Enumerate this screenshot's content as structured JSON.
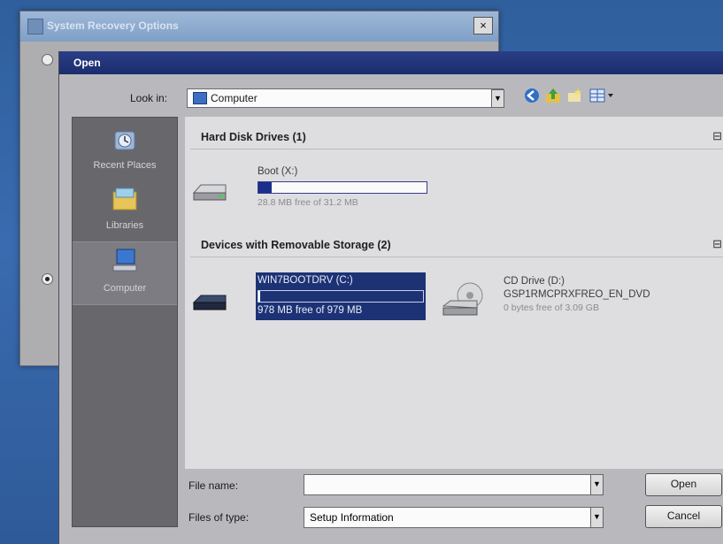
{
  "sro_window": {
    "title": "System Recovery Options",
    "close_label": "×"
  },
  "open_dialog": {
    "title": "Open",
    "look_in_label": "Look in:",
    "look_in_value": "Computer",
    "places": [
      {
        "label": "Recent Places"
      },
      {
        "label": "Libraries"
      },
      {
        "label": "Computer"
      }
    ],
    "groups": [
      {
        "title": "Hard Disk Drives (1)",
        "collapse": "⊟"
      },
      {
        "title": "Devices with Removable Storage (2)",
        "collapse": "⊟"
      }
    ],
    "drives": [
      {
        "name": "Boot (X:)",
        "free": "28.8 MB free of 31.2 MB",
        "used_fraction": 0.08
      },
      {
        "name": "WIN7BOOTDRV (C:)",
        "free": "978 MB free of 979 MB",
        "used_fraction": 0.01
      },
      {
        "name": "CD Drive (D:)",
        "label": "GSP1RMCPRXFREO_EN_DVD",
        "free": "0 bytes free of 3.09 GB"
      }
    ],
    "file_name_label": "File name:",
    "file_name_value": "",
    "files_of_type_label": "Files of type:",
    "files_of_type_value": "Setup Information",
    "open_button": "Open",
    "cancel_button": "Cancel"
  }
}
